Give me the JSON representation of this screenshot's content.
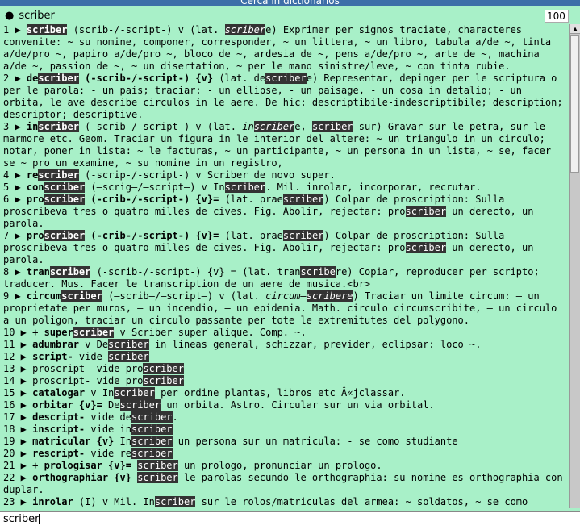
{
  "window": {
    "title": "Cerca in dictionarios"
  },
  "header": {
    "bullet": "●",
    "term": "scriber",
    "count": "100"
  },
  "entries": [
    [
      {
        "t": "1 ▶ "
      },
      {
        "t": "scriber",
        "b": 1,
        "h": 1
      },
      {
        "t": " (scrib-/-script-) v (lat. "
      },
      {
        "t": "scriber",
        "i": 1,
        "h": 1
      },
      {
        "t": "e) Exprimer per signos traciate, characteres convenite: ~ su nomine, componer, corresponder, ~ un littera, ~ un libro, tabula a/de ~, tinta a/de/pro ~, papiro a/de/pro ~, bloco de ~, ardesia de ~, pens a/de/pro ~, arte de ~, machina a/de ~, passion de ~, ~ un disertation, ~ per le mano sinistre/leve, ~ con tinta rubie."
      }
    ],
    [
      {
        "t": "2 ▶ "
      },
      {
        "t": "de",
        "b": 1
      },
      {
        "t": "scriber",
        "b": 1,
        "h": 1
      },
      {
        "t": " (-scrib-/-script-) {v}",
        "b": 1
      },
      {
        "t": " (lat. de"
      },
      {
        "t": "scriber",
        "h": 1
      },
      {
        "t": "e) Representar, depinger per le scriptura o per le parola: - un pais; traciar: - un ellipse, - un paisage, - un cosa in detalio; - un orbita, le ave describe circulos in le aere. De hic: descriptibile-indescriptibile; description; descriptor; descriptive."
      }
    ],
    [
      {
        "t": "3 ▶ "
      },
      {
        "t": "in",
        "b": 1
      },
      {
        "t": "scriber",
        "b": 1,
        "h": 1
      },
      {
        "t": " (-scrib-/-script-) v (lat. "
      },
      {
        "t": "in",
        "i": 1
      },
      {
        "t": "scriber",
        "i": 1,
        "h": 1
      },
      {
        "t": "e, "
      },
      {
        "t": "scriber",
        "h": 1
      },
      {
        "t": " sur) Gravar sur le petra, sur le marmore etc. Geom. Traciar un figura in le interior del altere: ~ un triangulo in un circulo; notar, poner in lista: ~ le facturas, ~ un participante, ~ un persona in un lista, ~ se, facer se ~ pro un examine, ~ su nomine in un registro,"
      }
    ],
    [
      {
        "t": "4 ▶ "
      },
      {
        "t": "re",
        "b": 1
      },
      {
        "t": "scriber",
        "b": 1,
        "h": 1
      },
      {
        "t": " (-scrip-/-script-) v Scriber de novo super."
      }
    ],
    [
      {
        "t": "5 ▶ "
      },
      {
        "t": "con",
        "b": 1
      },
      {
        "t": "scriber",
        "b": 1,
        "h": 1
      },
      {
        "t": " (—scrig—/—script—) v In"
      },
      {
        "t": "scriber",
        "h": 1
      },
      {
        "t": ". Mil. inrolar, incorporar, recrutar."
      }
    ],
    [
      {
        "t": "6 ▶ "
      },
      {
        "t": "pro",
        "b": 1
      },
      {
        "t": "scriber",
        "b": 1,
        "h": 1
      },
      {
        "t": " (-crib-/-script-) {v}=",
        "b": 1
      },
      {
        "t": " (lat. prae"
      },
      {
        "t": "scriber",
        "h": 1
      },
      {
        "t": ") Colpar de proscription: Sulla proscribeva tres o quatro milles de cives. Fig. Abolir, rejectar: pro"
      },
      {
        "t": "scriber",
        "h": 1
      },
      {
        "t": " un derecto, un parola."
      }
    ],
    [
      {
        "t": "7 ▶ "
      },
      {
        "t": "pro",
        "b": 1
      },
      {
        "t": "scriber",
        "b": 1,
        "h": 1
      },
      {
        "t": " (-crib-/-script-) {v}=",
        "b": 1
      },
      {
        "t": " (lat. prae"
      },
      {
        "t": "scriber",
        "h": 1
      },
      {
        "t": ") Colpar de proscription: Sulla proscribeva tres o quatro milles de cives. Fig. Abolir, rejectar: pro"
      },
      {
        "t": "scriber",
        "h": 1
      },
      {
        "t": " un derecto, un parola."
      }
    ],
    [
      {
        "t": "8 ▶ "
      },
      {
        "t": "tran",
        "b": 1
      },
      {
        "t": "scriber",
        "b": 1,
        "h": 1
      },
      {
        "t": " (-scrib-/-script-) {v} = (lat. tran"
      },
      {
        "t": "scribe",
        "h": 1
      },
      {
        "t": "re) Copiar, reproducer per scripto; traducer. Mus. Facer le transcription de un aere de musica.<br>"
      }
    ],
    [
      {
        "t": "9 ▶ "
      },
      {
        "t": "circum",
        "b": 1
      },
      {
        "t": "scriber",
        "b": 1,
        "h": 1
      },
      {
        "t": " (—scrib—/—script—) v (lat. "
      },
      {
        "t": "circum—",
        "i": 1
      },
      {
        "t": "scribere",
        "i": 1,
        "h": 1
      },
      {
        "t": ") Traciar un limite circum: — un proprietate per muros, — un incendio, — un epidemia. Math. circulo circumscribite, — un circulo a un poligon, traciar un circulo passante per tote le extremitutes del polygono."
      }
    ],
    [
      {
        "t": "10 ▶ "
      },
      {
        "t": "+ super",
        "b": 1
      },
      {
        "t": "scriber",
        "b": 1,
        "h": 1
      },
      {
        "t": " v Scriber super alique. Comp. ~."
      }
    ],
    [
      {
        "t": "11 ▶ "
      },
      {
        "t": "adumbrar",
        "b": 1
      },
      {
        "t": " v De"
      },
      {
        "t": "scriber",
        "h": 1
      },
      {
        "t": " in lineas general, schizzar, previder, eclipsar: loco ~."
      }
    ],
    [
      {
        "t": "12 ▶ "
      },
      {
        "t": "script-",
        "b": 1
      },
      {
        "t": " vide "
      },
      {
        "t": "scriber",
        "h": 1
      }
    ],
    [
      {
        "t": "13 ▶ proscript- vide pro"
      },
      {
        "t": "scriber",
        "h": 1
      }
    ],
    [
      {
        "t": "14 ▶ proscript- vide pro"
      },
      {
        "t": "scriber",
        "h": 1
      }
    ],
    [
      {
        "t": "15 ▶ "
      },
      {
        "t": "catalogar",
        "b": 1
      },
      {
        "t": " v In"
      },
      {
        "t": "scriber",
        "h": 1
      },
      {
        "t": " per ordine plantas, libros etc Â«jclassar."
      }
    ],
    [
      {
        "t": "16 ▶ "
      },
      {
        "t": "orbitar {v}=",
        "b": 1
      },
      {
        "t": " De"
      },
      {
        "t": "scriber",
        "h": 1
      },
      {
        "t": " un orbita. Astro. Circular sur un via orbital."
      }
    ],
    [
      {
        "t": "17 ▶ "
      },
      {
        "t": "descript-",
        "b": 1
      },
      {
        "t": " vide de"
      },
      {
        "t": "scriber",
        "h": 1
      },
      {
        "t": "."
      }
    ],
    [
      {
        "t": "18 ▶ "
      },
      {
        "t": "inscript-",
        "b": 1
      },
      {
        "t": " vide in"
      },
      {
        "t": "scriber",
        "h": 1
      }
    ],
    [
      {
        "t": "19 ▶ "
      },
      {
        "t": "matricular {v}",
        "b": 1
      },
      {
        "t": " In"
      },
      {
        "t": "scriber",
        "h": 1
      },
      {
        "t": " un persona sur un matricula: - se como studiante"
      }
    ],
    [
      {
        "t": "20 ▶ "
      },
      {
        "t": "rescript-",
        "b": 1
      },
      {
        "t": " vide re"
      },
      {
        "t": "scriber",
        "h": 1
      }
    ],
    [
      {
        "t": "21 ▶ "
      },
      {
        "t": "+ prologisar {v}=",
        "b": 1
      },
      {
        "t": " "
      },
      {
        "t": "scriber",
        "h": 1
      },
      {
        "t": " un prologo, pronunciar un prologo."
      }
    ],
    [
      {
        "t": "22 ▶ "
      },
      {
        "t": "orthographiar {v}",
        "b": 1
      },
      {
        "t": " "
      },
      {
        "t": "scriber",
        "h": 1
      },
      {
        "t": " le parolas secundo le orthographia: su nomine es orthographia con duplar."
      }
    ],
    [
      {
        "t": "23 ▶ "
      },
      {
        "t": "inrolar",
        "b": 1
      },
      {
        "t": " (I) v Mil. In"
      },
      {
        "t": "scriber",
        "h": 1
      },
      {
        "t": " sur le rolos/matriculas del armea: ~ soldatos, ~ se como soldato, ~ marineros; entrar en le arema."
      }
    ],
    [
      {
        "t": "24 ▶ "
      },
      {
        "t": "listar {v}",
        "b": 1
      },
      {
        "t": " Entrar, In"
      },
      {
        "t": "scriber",
        "h": 1
      },
      {
        "t": " in lista, Inform.: -."
      }
    ]
  ],
  "search": {
    "value": "scriber"
  }
}
